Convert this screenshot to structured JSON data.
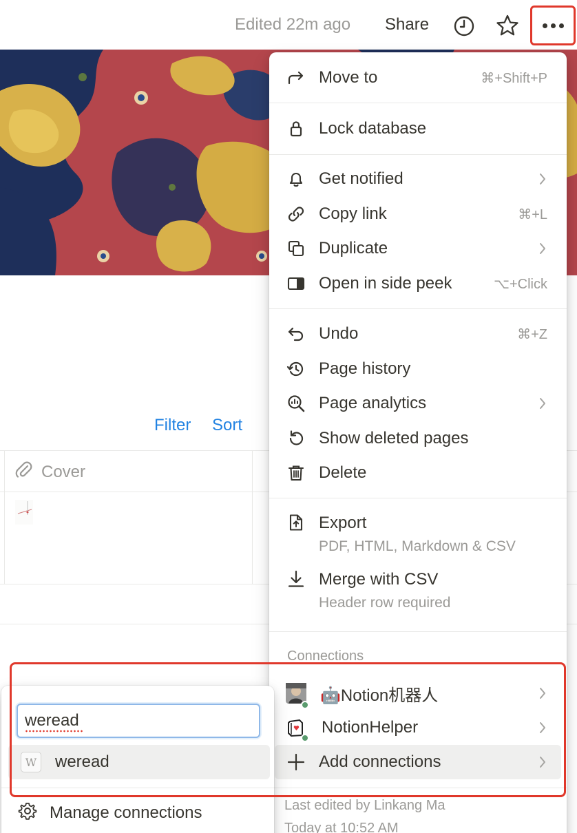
{
  "topbar": {
    "edited": "Edited 22m ago",
    "share": "Share",
    "icons": [
      "clock-icon",
      "star-icon",
      "more-icon"
    ]
  },
  "database": {
    "filter": "Filter",
    "sort": "Sort",
    "columns": [
      "Cover"
    ]
  },
  "menu": {
    "items": [
      {
        "label": "Move to",
        "shortcut": "⌘+Shift+P",
        "icon": "arrow-turn-right-icon"
      },
      {
        "label": "Lock database",
        "icon": "lock-icon"
      },
      {
        "label": "Get notified",
        "icon": "bell-icon",
        "submenu": true
      },
      {
        "label": "Copy link",
        "shortcut": "⌘+L",
        "icon": "link-icon"
      },
      {
        "label": "Duplicate",
        "icon": "duplicate-icon",
        "submenu": true
      },
      {
        "label": "Open in side peek",
        "shortcut": "⌥+Click",
        "icon": "side-peek-icon"
      },
      {
        "label": "Undo",
        "shortcut": "⌘+Z",
        "icon": "undo-icon"
      },
      {
        "label": "Page history",
        "icon": "history-icon"
      },
      {
        "label": "Page analytics",
        "icon": "analytics-icon",
        "submenu": true
      },
      {
        "label": "Show deleted pages",
        "icon": "restore-icon"
      },
      {
        "label": "Delete",
        "icon": "trash-icon"
      },
      {
        "label": "Export",
        "sub": "PDF, HTML, Markdown & CSV",
        "icon": "export-icon"
      },
      {
        "label": "Merge with CSV",
        "sub": "Header row required",
        "icon": "download-icon"
      }
    ],
    "connections_title": "Connections",
    "connections": [
      {
        "label": "🤖Notion机器人",
        "icon": "avatar",
        "submenu": true
      },
      {
        "label": "NotionHelper",
        "icon": "helper-logo",
        "submenu": true
      },
      {
        "label": "Add connections",
        "icon": "plus-icon",
        "submenu": true
      }
    ],
    "footer": {
      "line1": "Last edited by Linkang Ma",
      "line2": "Today at 10:52 AM"
    }
  },
  "popup": {
    "search_value": "weread",
    "result": {
      "letter": "W",
      "label": "weread"
    },
    "manage": "Manage connections"
  }
}
